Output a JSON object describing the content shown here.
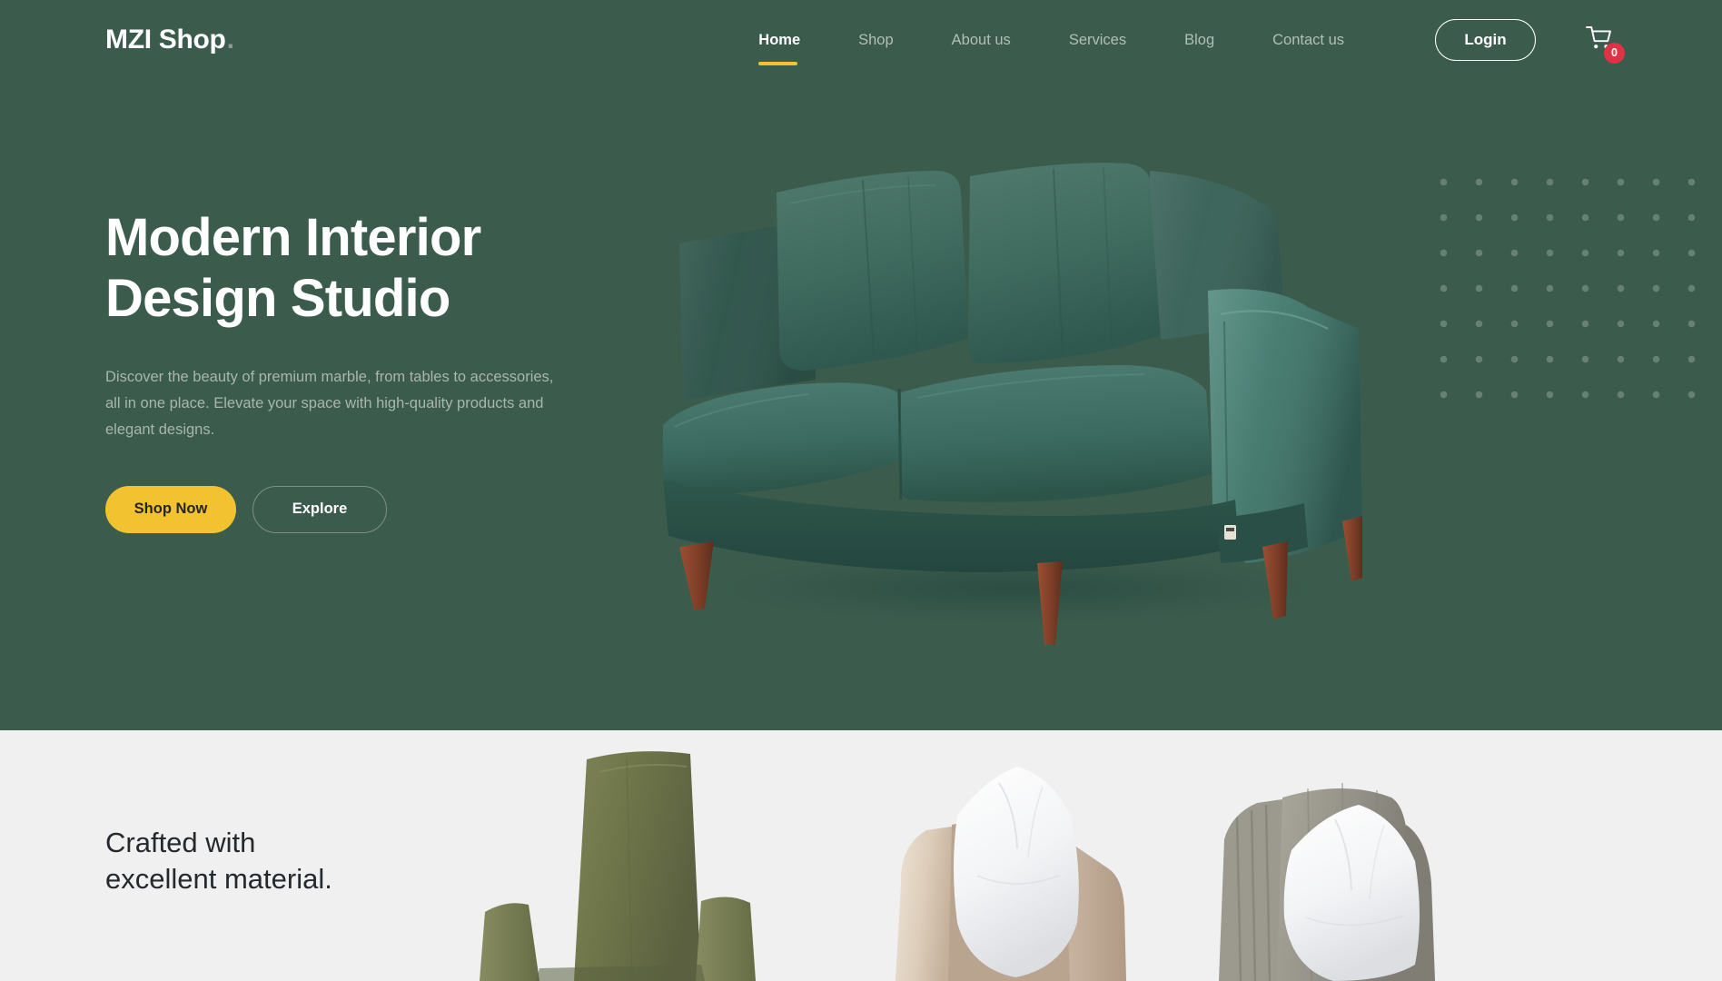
{
  "brand": {
    "name": "MZI Shop",
    "dot": "."
  },
  "nav": {
    "items": [
      {
        "label": "Home",
        "active": true
      },
      {
        "label": "Shop",
        "active": false
      },
      {
        "label": "About us",
        "active": false
      },
      {
        "label": "Services",
        "active": false
      },
      {
        "label": "Blog",
        "active": false
      },
      {
        "label": "Contact us",
        "active": false
      }
    ]
  },
  "header_actions": {
    "login_label": "Login",
    "cart_icon": "shopping-cart-icon",
    "cart_count": "0"
  },
  "hero": {
    "title": "Modern Interior\nDesign Studio",
    "subtitle": "Discover the beauty of premium marble, from tables to accessories, all in one place. Elevate your space with high-quality products and elegant designs.",
    "primary_cta": "Shop Now",
    "secondary_cta": "Explore",
    "image_alt": "green-velvet-sofa"
  },
  "section_crafted": {
    "title": "Crafted with\nexcellent material.",
    "products": [
      {
        "alt": "olive-green-armchair"
      },
      {
        "alt": "beige-armchair-with-white-pillow"
      },
      {
        "alt": "grey-armchair-with-white-pillow"
      }
    ]
  },
  "colors": {
    "hero_bg": "#3b5c4d",
    "accent_yellow": "#f2c230",
    "badge_red": "#e03245",
    "light_bg": "#f0f0f0",
    "nav_muted": "#b4bdb8",
    "dot_pattern": "#8a9e94"
  }
}
